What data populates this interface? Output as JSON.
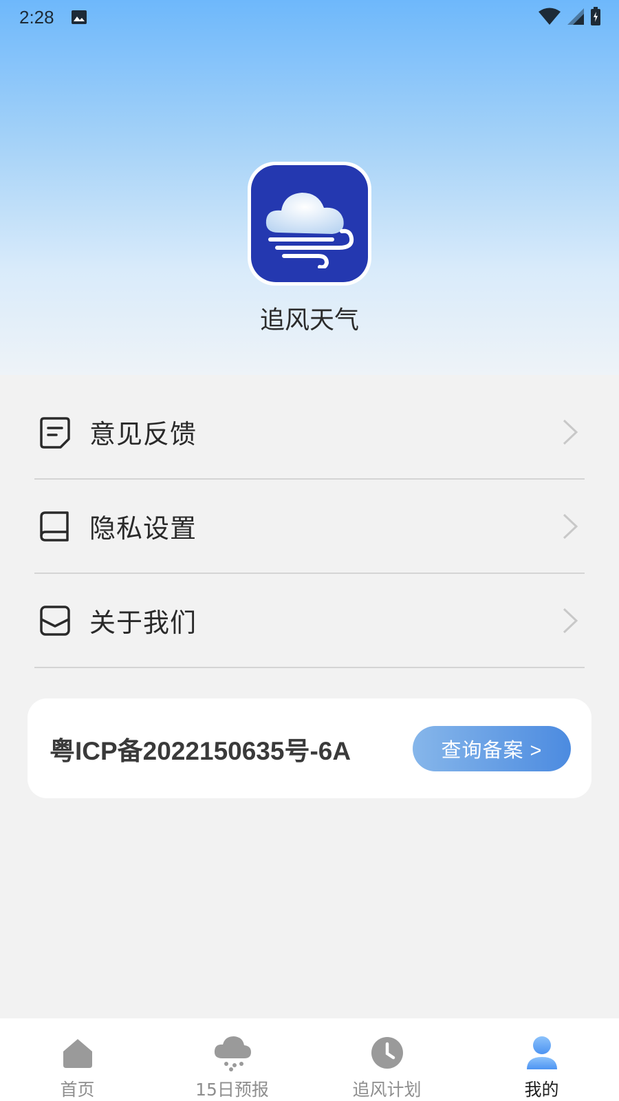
{
  "status_bar": {
    "time": "2:28",
    "icons": [
      "image-icon",
      "wifi-icon",
      "signal-icon",
      "battery-icon"
    ]
  },
  "app": {
    "name": "追风天气",
    "logo_icon": "cloud-wind-logo",
    "logo_color": "#2438b0"
  },
  "menu": {
    "items": [
      {
        "label": "意见反馈",
        "icon": "feedback-icon"
      },
      {
        "label": "隐私设置",
        "icon": "book-icon"
      },
      {
        "label": "关于我们",
        "icon": "envelope-icon"
      }
    ]
  },
  "icp": {
    "text": "粤ICP备2022150635号-6A",
    "button_label": "查询备案 >",
    "button_color": "#4c8be0"
  },
  "tabbar": {
    "tabs": [
      {
        "label": "首页",
        "icon": "home-icon"
      },
      {
        "label": "15日预报",
        "icon": "cloud-rain-icon"
      },
      {
        "label": "追风计划",
        "icon": "clock-icon"
      },
      {
        "label": "我的",
        "icon": "user-icon"
      }
    ],
    "active_index": 3
  }
}
